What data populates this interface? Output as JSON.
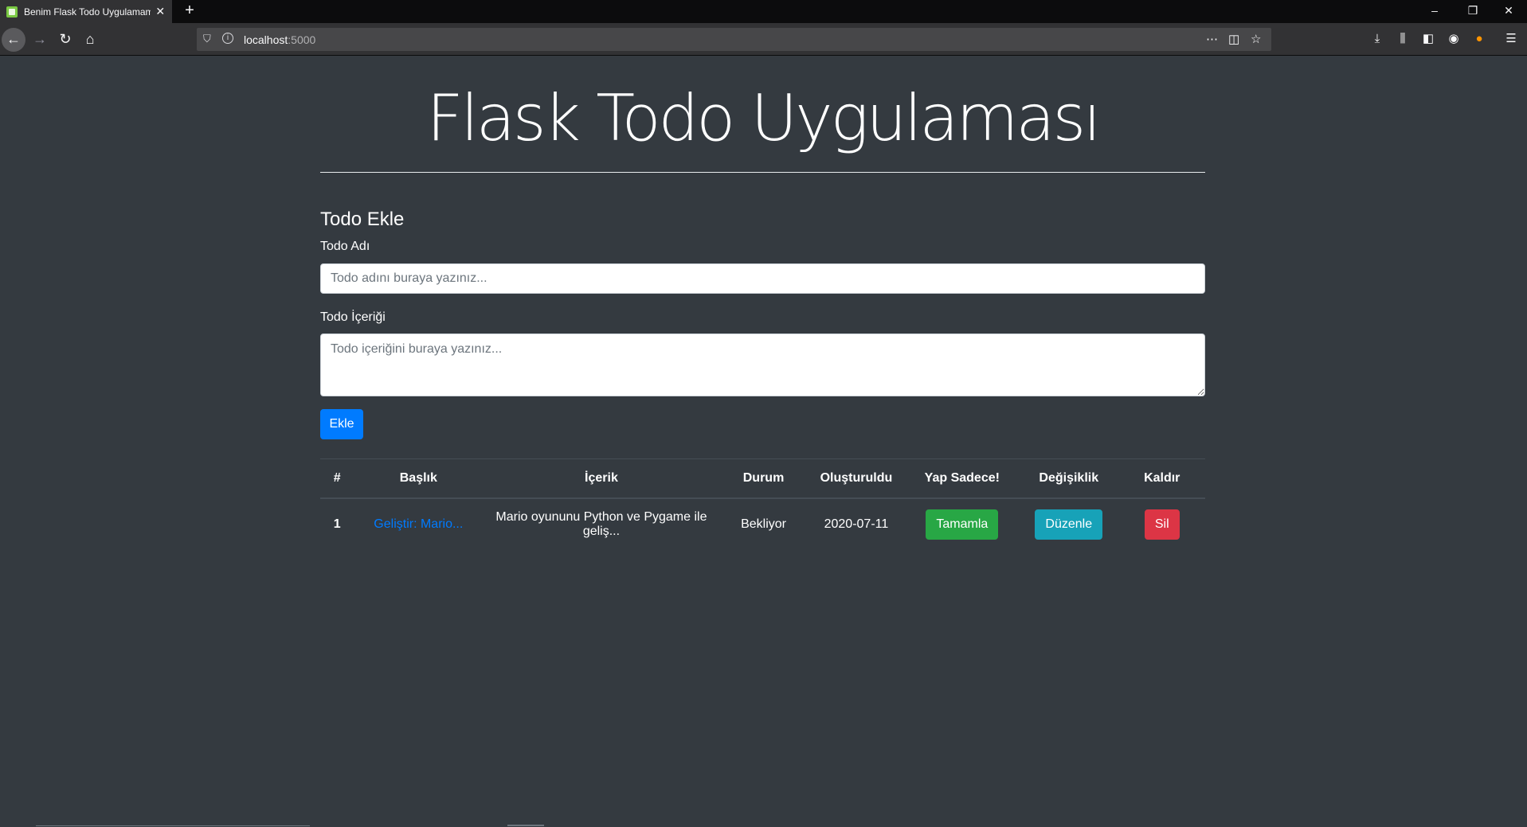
{
  "browser": {
    "tab_title": "Benim Flask Todo Uygulamam",
    "url_host": "localhost",
    "url_port": ":5000"
  },
  "page": {
    "title": "Flask Todo Uygulaması",
    "form_title": "Todo Ekle",
    "name_label": "Todo Adı",
    "name_placeholder": "Todo adını buraya yazınız...",
    "content_label": "Todo İçeriği",
    "content_placeholder": "Todo içeriğini buraya yazınız...",
    "add_button": "Ekle"
  },
  "table": {
    "headers": [
      "#",
      "Başlık",
      "İçerik",
      "Durum",
      "Oluşturuldu",
      "Yap Sadece!",
      "Değişiklik",
      "Kaldır"
    ],
    "rows": [
      {
        "num": "1",
        "title": "Geliştir: Mario...",
        "content": "Mario oyununu Python ve Pygame ile geliş...",
        "status": "Bekliyor",
        "created": "2020-07-11",
        "complete_label": "Tamamla",
        "edit_label": "Düzenle",
        "delete_label": "Sil"
      }
    ]
  },
  "colors": {
    "background": "#343a40",
    "primary": "#007bff",
    "success": "#28a745",
    "info": "#17a2b8",
    "danger": "#dc3545"
  }
}
